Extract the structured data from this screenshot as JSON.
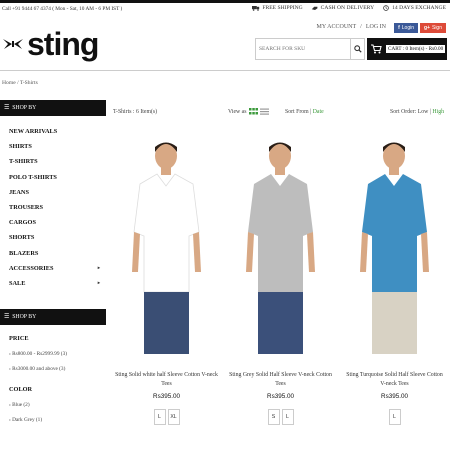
{
  "topbar": {
    "contact": "Call +91 9444 67 4374 ( Mon - Sat, 10 AM - 6 PM IST )",
    "free_shipping": "FREE SHIPPING",
    "cod": "CASH ON DELIVERY",
    "exchange": "14 DAYS EXCHANGE"
  },
  "brand": {
    "logo_text": "sting"
  },
  "account": {
    "my_account": "MY ACCOUNT",
    "separator": "/",
    "login": "LOG IN"
  },
  "social": {
    "facebook": "Login",
    "google": "Sign"
  },
  "search": {
    "placeholder": "SEARCH FOR SKU"
  },
  "cart": {
    "label": "CART : 0 Item(s) - Rs0.00"
  },
  "breadcrumb": "Home / T-Shirts",
  "sidebar": {
    "shop_by": "SHOP BY",
    "categories": [
      {
        "label": "NEW ARRIVALS",
        "caret": false
      },
      {
        "label": "SHIRTS",
        "caret": false
      },
      {
        "label": "T-SHIRTS",
        "caret": false
      },
      {
        "label": "POLO T-SHIRTS",
        "caret": false
      },
      {
        "label": "JEANS",
        "caret": false
      },
      {
        "label": "TROUSERS",
        "caret": false
      },
      {
        "label": "CARGOS",
        "caret": false
      },
      {
        "label": "SHORTS",
        "caret": false
      },
      {
        "label": "BLAZERS",
        "caret": false
      },
      {
        "label": "ACCESSORIES",
        "caret": true
      },
      {
        "label": "SALE",
        "caret": true
      }
    ],
    "shop_by_2": "SHOP BY",
    "price_title": "PRICE",
    "price_options": [
      "Rs800.00 - Rs2999.99 (3)",
      "Rs3000.00 and above (3)"
    ],
    "color_title": "COLOR",
    "color_options": [
      "Blue (2)",
      "Dark Grey (1)"
    ]
  },
  "toolbar": {
    "count": "T-Shirts : 6 Item(s)",
    "view_as": "View as",
    "sort_from": "Sort From",
    "sort_from_value": "Date",
    "sort_order": "Sort Order: Low",
    "sort_order_value": "High"
  },
  "products": [
    {
      "name": "Sting Solid white half Sleeve Cotton V-neck Tees",
      "price": "Rs395.00",
      "sizes": [
        "L",
        "XL"
      ],
      "shirt_color": "#ffffff",
      "jeans_color": "#3a4e74"
    },
    {
      "name": "Sting Grey Solid Half Sleeve V-neck Cotton Tees",
      "price": "Rs395.00",
      "sizes": [
        "S",
        "L"
      ],
      "shirt_color": "#bdbdbd",
      "jeans_color": "#3b507a"
    },
    {
      "name": "Sting Turquoise Solid Half Sleeve Cotton V-neck Tees",
      "price": "Rs395.00",
      "sizes": [
        "L"
      ],
      "shirt_color": "#3f8fc2",
      "jeans_color": "#d8d2c4"
    }
  ],
  "colors": {
    "accent_green": "#3b9a3b",
    "dark": "#111111"
  }
}
